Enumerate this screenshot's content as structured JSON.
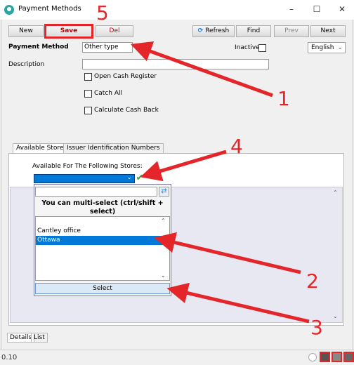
{
  "window": {
    "title": "Payment Methods",
    "minimize": "–",
    "maximize": "☐",
    "close": "✕"
  },
  "toolbar": {
    "new": "New",
    "save": "Save",
    "del": "Del",
    "refresh": "Refresh",
    "find": "Find",
    "prev": "Prev",
    "next": "Next"
  },
  "form": {
    "payment_method_label": "Payment Method",
    "payment_method_value": "Other type",
    "inactive_label": "Inactive",
    "language": "English",
    "description_label": "Description",
    "description_value": "",
    "checkboxes": [
      "Open Cash Register",
      "Catch All",
      "Calculate Cash Back"
    ]
  },
  "tabs": [
    "Available Stores",
    "Issuer Identification Numbers"
  ],
  "stores": {
    "label": "Available For The Following Stores:",
    "selected_value": "",
    "search_value": "",
    "hint": "You can multi-select (ctrl/shift + select)",
    "items": [
      "Cantley office",
      "Ottawa"
    ],
    "select_button": "Select"
  },
  "bottom_tabs": [
    "Details",
    "List"
  ],
  "status": {
    "version": "0.10"
  },
  "annotations": [
    "1",
    "2",
    "3",
    "4",
    "5"
  ],
  "colors": {
    "annotation": "#e4262a",
    "selection": "#0078d7",
    "accent_red": "#c00000"
  }
}
